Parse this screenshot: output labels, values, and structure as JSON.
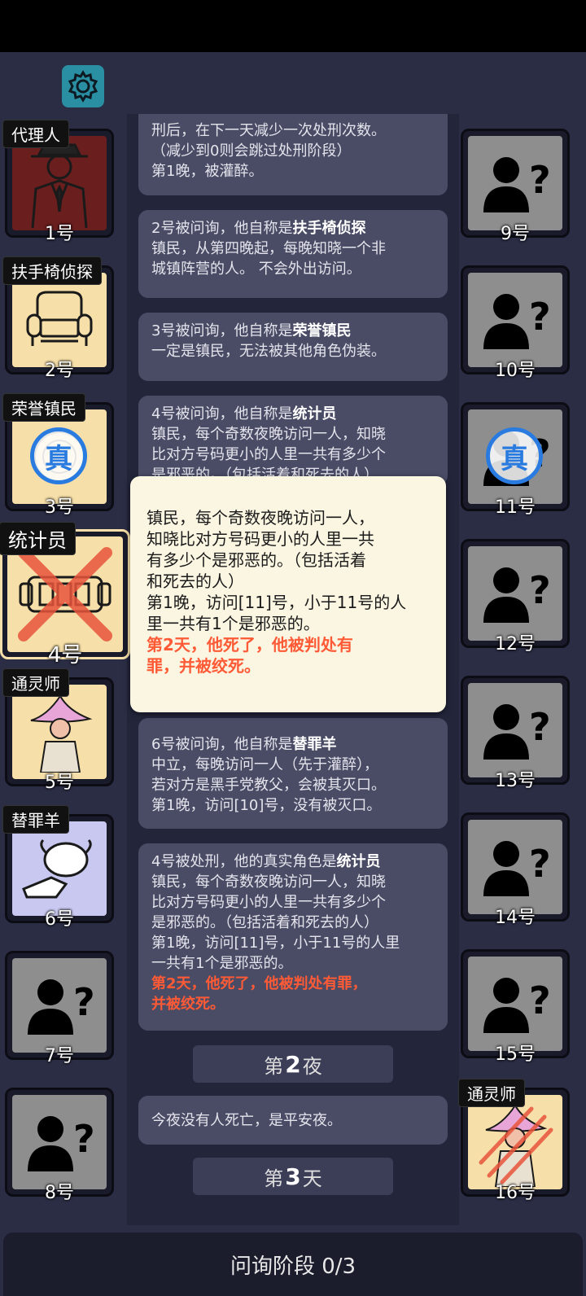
{
  "settings": {
    "icon": "gear-icon"
  },
  "left_players": [
    {
      "number": "1号",
      "role": "代理人",
      "icon": "agent-icon",
      "bg": "#6b1e1e",
      "revealed_true": false,
      "dead": false
    },
    {
      "number": "2号",
      "role": "扶手椅侦探",
      "icon": "armchair-icon",
      "bg": "#f6dfa8",
      "revealed_true": false,
      "dead": false
    },
    {
      "number": "3号",
      "role": "荣誉镇民",
      "icon": "medal-icon",
      "bg": "#f6dfa8",
      "revealed_true": true,
      "dead": false
    },
    {
      "number": "4号",
      "role": "统计员",
      "icon": "counter-icon",
      "bg": "#f6dfa8",
      "revealed_true": false,
      "dead": true
    },
    {
      "number": "5号",
      "role": "通灵师",
      "icon": "medium-icon",
      "bg": "#f6dfa8",
      "revealed_true": false,
      "dead": false
    },
    {
      "number": "6号",
      "role": "替罪羊",
      "icon": "sheep-icon",
      "bg": "#c8c8f0",
      "revealed_true": false,
      "dead": false
    },
    {
      "number": "7号",
      "role": "",
      "icon": "unknown-person-icon",
      "bg": "#8e8e8e",
      "revealed_true": false,
      "dead": false
    },
    {
      "number": "8号",
      "role": "",
      "icon": "unknown-person-icon",
      "bg": "#8e8e8e",
      "revealed_true": false,
      "dead": false
    }
  ],
  "right_players": [
    {
      "number": "9号",
      "role": "",
      "icon": "unknown-person-icon",
      "bg": "#8e8e8e",
      "revealed_true": false,
      "dead": false
    },
    {
      "number": "10号",
      "role": "",
      "icon": "unknown-person-icon",
      "bg": "#8e8e8e",
      "revealed_true": false,
      "dead": false
    },
    {
      "number": "11号",
      "role": "",
      "icon": "unknown-person-icon",
      "bg": "#8e8e8e",
      "revealed_true": true,
      "dead": false
    },
    {
      "number": "12号",
      "role": "",
      "icon": "unknown-person-icon",
      "bg": "#8e8e8e",
      "revealed_true": false,
      "dead": false
    },
    {
      "number": "13号",
      "role": "",
      "icon": "unknown-person-icon",
      "bg": "#8e8e8e",
      "revealed_true": false,
      "dead": false
    },
    {
      "number": "14号",
      "role": "",
      "icon": "unknown-person-icon",
      "bg": "#8e8e8e",
      "revealed_true": false,
      "dead": false
    },
    {
      "number": "15号",
      "role": "",
      "icon": "unknown-person-icon",
      "bg": "#8e8e8e",
      "revealed_true": false,
      "dead": false
    },
    {
      "number": "16号",
      "role": "通灵师",
      "icon": "medium-icon",
      "bg": "#f6dfa8",
      "revealed_true": false,
      "dead": true
    }
  ],
  "true_badge": "真",
  "log": {
    "m1": {
      "l1": "刑后，在下一天减少一次处刑次数。",
      "l2": "（减少到0则会跳过处刑阶段）",
      "l3": "第1晚，被灌醉。"
    },
    "m2": {
      "pre": "2号被问询，他自称是",
      "role": "扶手椅侦探",
      "l2": "镇民，从第四晚起，每晚知晓一个非",
      "l3": "城镇阵营的人。 不会外出访问。"
    },
    "m3": {
      "pre": "3号被问询，他自称是",
      "role": "荣誉镇民",
      "l2": "一定是镇民，无法被其他角色伪装。"
    },
    "m4": {
      "pre": "4号被问询，他自称是",
      "role": "统计员",
      "l2": "镇民，每个奇数夜晚访问一人，知晓",
      "l3": "比对方号码更小的人里一共有多少个",
      "l4": "是邪恶的。（包括活着和死去的人）"
    },
    "m6": {
      "pre": "6号被问询，他自称是",
      "role": "替罪羊",
      "l2": "中立，每晚访问一人（先于灌醉），",
      "l3": "若对方是黑手党教父，会被其灭口。",
      "l4": "第1晚，访问[10]号，没有被灭口。"
    },
    "m7": {
      "pre": "4号被处刑，他的真实角色是",
      "role": "统计员",
      "l2": "镇民，每个奇数夜晚访问一人，知晓",
      "l3": "比对方号码更小的人里一共有多少个",
      "l4": "是邪恶的。（包括活着和死去的人）",
      "l5": "第1晚，访问[11]号，小于11号的人里",
      "l6": "一共有1个是邪恶的。",
      "red1": "第2天，他死了，他被判处有罪，",
      "red2": "并被绞死。"
    },
    "night2": {
      "pre": "第",
      "num": "2",
      "post": "夜"
    },
    "m8": {
      "text": "今夜没有人死亡，是平安夜。"
    },
    "day3": {
      "pre": "第",
      "num": "3",
      "post": "天"
    }
  },
  "popup": {
    "l1": "镇民，每个奇数夜晚访问一人，",
    "l2": "知晓比对方号码更小的人里一共",
    "l3": "有多少个是邪恶的。（包括活着",
    "l4": "和死去的人）",
    "l5": "第1晚，访问[11]号，小于11号的人",
    "l6": "里一共有1个是邪恶的。",
    "red1": "第2天，他死了，他被判处有",
    "red2": "罪，并被绞死。"
  },
  "footer": {
    "phase": "问询阶段 0/3"
  },
  "colors": {
    "background": "#2b2d45",
    "message": "#4a4c66",
    "highlight_red": "#ff5a36",
    "true_badge": "#2a7be0",
    "popup": "#fbf6e2"
  }
}
